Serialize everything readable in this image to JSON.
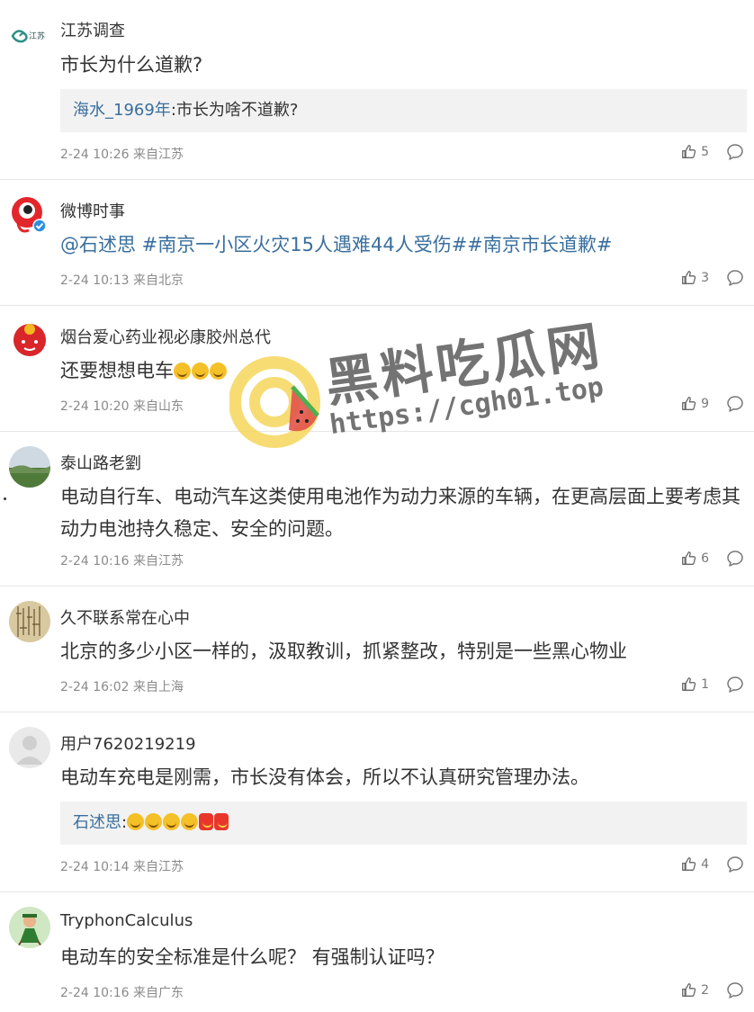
{
  "comments": [
    {
      "username": "江苏调查",
      "content": "市长为什么道歉?",
      "reply": {
        "name": "海水_1969年",
        "text": ":市长为啥不道歉?"
      },
      "meta": "2-24 10:26 来自江苏",
      "likes": "5"
    },
    {
      "username": "微博时事",
      "content": "@石述思 #南京一小区火灾15人遇难44人受伤##南京市长道歉#",
      "meta": "2-24 10:13 来自北京",
      "likes": "3"
    },
    {
      "username": "烟台爱心药业视必康胶州总代",
      "content": "还要想想电车",
      "meta": "2-24 10:20 来自山东",
      "likes": "9"
    },
    {
      "username": "泰山路老劉",
      "content": "电动自行车、电动汽车这类使用电池作为动力来源的车辆，在更高层面上要考虑其动力电池持久稳定、安全的问题。",
      "meta": "2-24 10:16 来自江苏",
      "likes": "6"
    },
    {
      "username": "久不联系常在心中",
      "content": "北京的多少小区一样的，汲取教训，抓紧整改，特别是一些黑心物业",
      "meta": "2-24 16:02 来自上海",
      "likes": "1"
    },
    {
      "username": "用户7620219219",
      "content": "电动车充电是刚需，市长没有体会，所以不认真研究管理办法。",
      "reply": {
        "name": "石述思",
        "text": ":"
      },
      "meta": "2-24 10:14 来自江苏",
      "likes": "4"
    },
    {
      "username": "TryphonCalculus",
      "content": "电动车的安全标准是什么呢？ 有强制认证吗？",
      "meta": "2-24 10:16 来自广东",
      "likes": "2"
    }
  ],
  "watermark": {
    "title": "黑料吃瓜网",
    "url": "https://cgh01.top"
  },
  "avatar_logo_text": "江苏",
  "colors": {
    "link": "#3a6f9e",
    "meta": "#8a8a8a",
    "divider": "#e6e6e6",
    "reply_bg": "#f2f2f2"
  }
}
